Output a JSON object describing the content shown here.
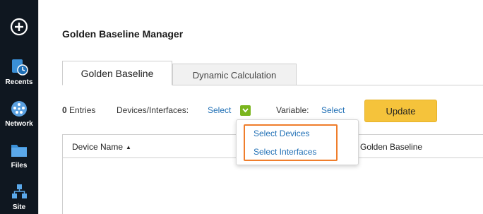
{
  "sidebar": {
    "items": [
      {
        "icon": "add-circle-icon",
        "label": ""
      },
      {
        "icon": "recents-icon",
        "label": "Recents"
      },
      {
        "icon": "network-icon",
        "label": "Network"
      },
      {
        "icon": "folder-icon",
        "label": "Files"
      },
      {
        "icon": "site-icon",
        "label": "Site"
      }
    ]
  },
  "page": {
    "title": "Golden Baseline Manager"
  },
  "tabs": [
    {
      "label": "Golden Baseline",
      "active": true
    },
    {
      "label": "Dynamic Calculation",
      "active": false
    }
  ],
  "filter": {
    "entries_count": "0",
    "entries_label": "Entries",
    "devices_label": "Devices/Interfaces:",
    "devices_link": "Select",
    "variable_label": "Variable:",
    "variable_link": "Select",
    "update_label": "Update"
  },
  "table": {
    "columns": [
      {
        "label": "Device Name",
        "sort": "asc"
      },
      {
        "label": "Golden Baseline"
      }
    ],
    "rows": []
  },
  "dropdown": {
    "options": [
      "Select Devices",
      "Select Interfaces"
    ]
  },
  "colors": {
    "rail": "#0f1720",
    "accent_link": "#1f6fb5",
    "update_button": "#f5c33b",
    "checkbox": "#7ab51d",
    "highlight": "#ef7d2b"
  }
}
